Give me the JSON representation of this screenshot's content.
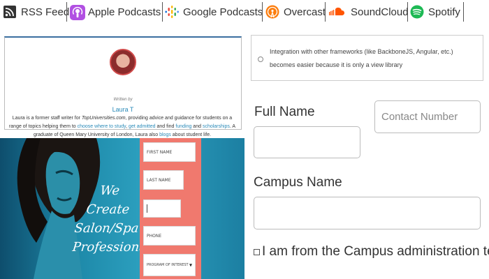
{
  "podcast_bar": {
    "items": [
      {
        "label": "RSS Feed",
        "icon": "rss-icon"
      },
      {
        "label": "Apple Podcasts",
        "icon": "apple-podcasts-icon"
      },
      {
        "label": "Google Podcasts",
        "icon": "google-podcasts-icon"
      },
      {
        "label": "Overcast",
        "icon": "overcast-icon"
      },
      {
        "label": "SoundCloud",
        "icon": "soundcloud-icon"
      },
      {
        "label": "Spotify",
        "icon": "spotify-icon"
      }
    ],
    "colors": {
      "apple": "#b150e2",
      "overcast": "#fc7e0f",
      "soundcloud": "#ff5500",
      "spotify": "#1db954"
    }
  },
  "author": {
    "written_by": "Written by",
    "name": "Laura T",
    "bio": {
      "p1": "Laura is a former staff writer for ",
      "site": "TopUniversities.com",
      "p2": ", providing advice and guidance for students on a range of topics helping them to ",
      "link1": "choose where to study",
      "sep1": ", ",
      "link2": "get admitted",
      "p3": " and find ",
      "link3": "funding",
      "p4": " and ",
      "link4": "scholarships",
      "p5": ". A graduate of Queen Mary University of London, Laura also ",
      "link5": "blogs",
      "p6": " about student life."
    }
  },
  "promo": {
    "headline_line1": "We Create",
    "headline_line2": "Salon/Spa",
    "headline_line3": "Professionals",
    "form": {
      "first_name": "FIRST NAME",
      "last_name": "LAST NAME",
      "phone": "PHONE",
      "program": "PROGRAM OF INTEREST"
    },
    "colors": {
      "form_bg": "#f0796e",
      "teal": "#2da1c0"
    }
  },
  "library_option": {
    "text": "Integration with other frameworks (like BackboneJS, Angular, etc.) becomes easier because it is only a view library"
  },
  "contact_form": {
    "full_name_label": "Full Name",
    "full_name_value": "",
    "contact_number_placeholder": "Contact Number",
    "campus_name_label": "Campus Name",
    "campus_name_value": "",
    "admin_checkbox_label": "I am from the Campus administration team"
  }
}
